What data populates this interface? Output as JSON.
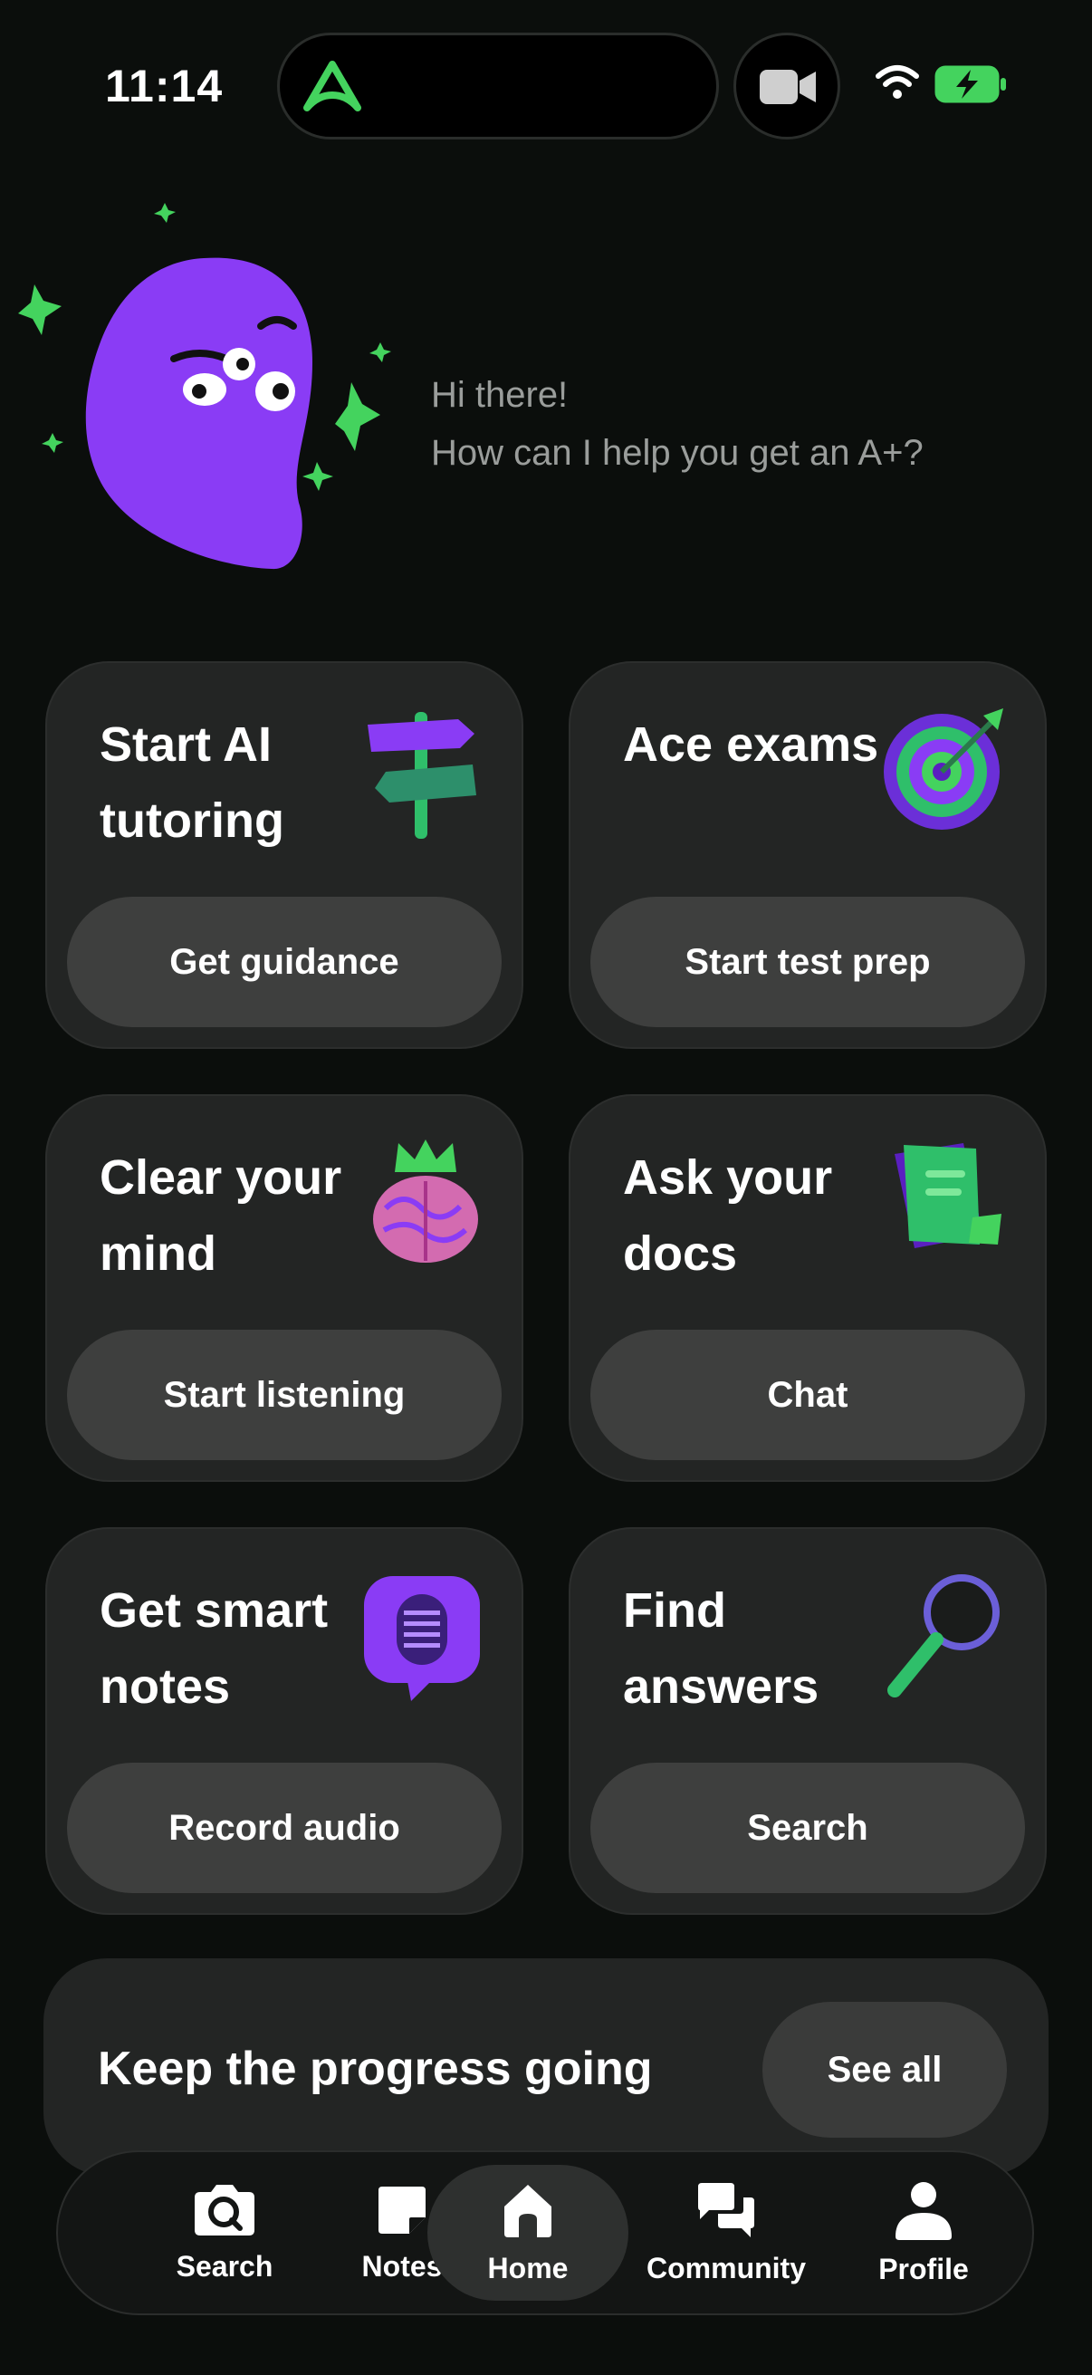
{
  "status": {
    "time": "11:14"
  },
  "greeting": {
    "line1": "Hi there!",
    "line2": "How can I help you get an A+?"
  },
  "cards": [
    {
      "title": "Start AI tutoring",
      "button": "Get guidance",
      "icon": "signpost-icon"
    },
    {
      "title": "Ace exams",
      "button": "Start test prep",
      "icon": "target-icon"
    },
    {
      "title": "Clear your mind",
      "button": "Start listening",
      "icon": "brain-crown-icon"
    },
    {
      "title": "Ask your docs",
      "button": "Chat",
      "icon": "document-icon"
    },
    {
      "title": "Get smart notes",
      "button": "Record audio",
      "icon": "microphone-bubble-icon"
    },
    {
      "title": "Find answers",
      "button": "Search",
      "icon": "magnifier-icon"
    }
  ],
  "progress": {
    "title": "Keep the progress going",
    "see_all": "See all"
  },
  "tabs": [
    {
      "label": "Search",
      "icon": "camera-search-icon"
    },
    {
      "label": "Notes",
      "icon": "note-icon"
    },
    {
      "label": "Home",
      "icon": "home-icon",
      "active": true
    },
    {
      "label": "Community",
      "icon": "chat-bubbles-icon"
    },
    {
      "label": "Profile",
      "icon": "person-icon"
    }
  ],
  "colors": {
    "accent": "#44d35e",
    "mascot": "#8a3cf5",
    "background": "#0b0e0c",
    "card": "#232524"
  }
}
